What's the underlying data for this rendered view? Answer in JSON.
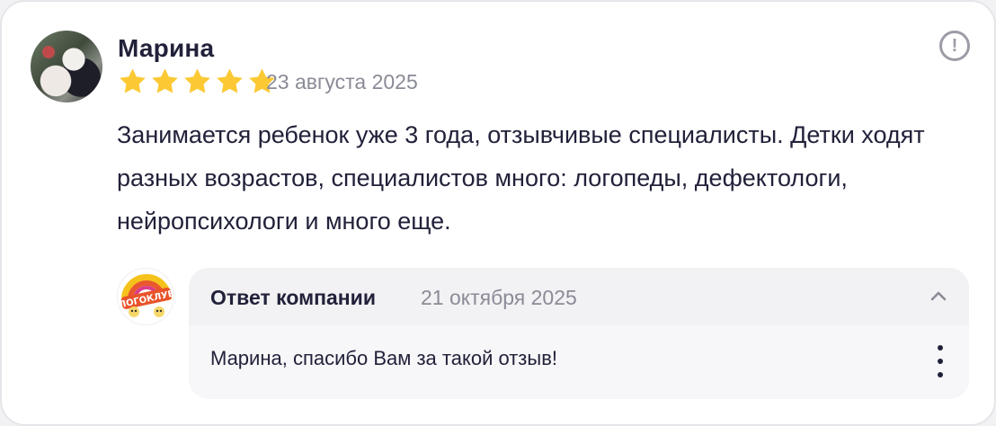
{
  "review": {
    "author_name": "Марина",
    "rating": 5,
    "rating_max": 5,
    "date": "23 августа 2025",
    "text": "Занимается ребенок уже 3 года, отзывчивые специалисты. Детки ходят разных возрастов, специалистов много: логопеды, дефектологи, нейропсихологи и много еще.",
    "report_icon": "exclamation-circle-icon"
  },
  "company_reply": {
    "title": "Ответ компании",
    "date": "21 октября 2025",
    "text": "Марина, спасибо Вам за такой отзыв!",
    "logo_text": "ЛОГОКЛУБ",
    "collapse_icon": "chevron-up-icon",
    "more_icon": "vertical-dots-icon"
  },
  "colors": {
    "star": "#fcc934",
    "text_primary": "#21213a",
    "text_secondary": "#8a8b96",
    "reply_background": "#f2f2f4"
  }
}
